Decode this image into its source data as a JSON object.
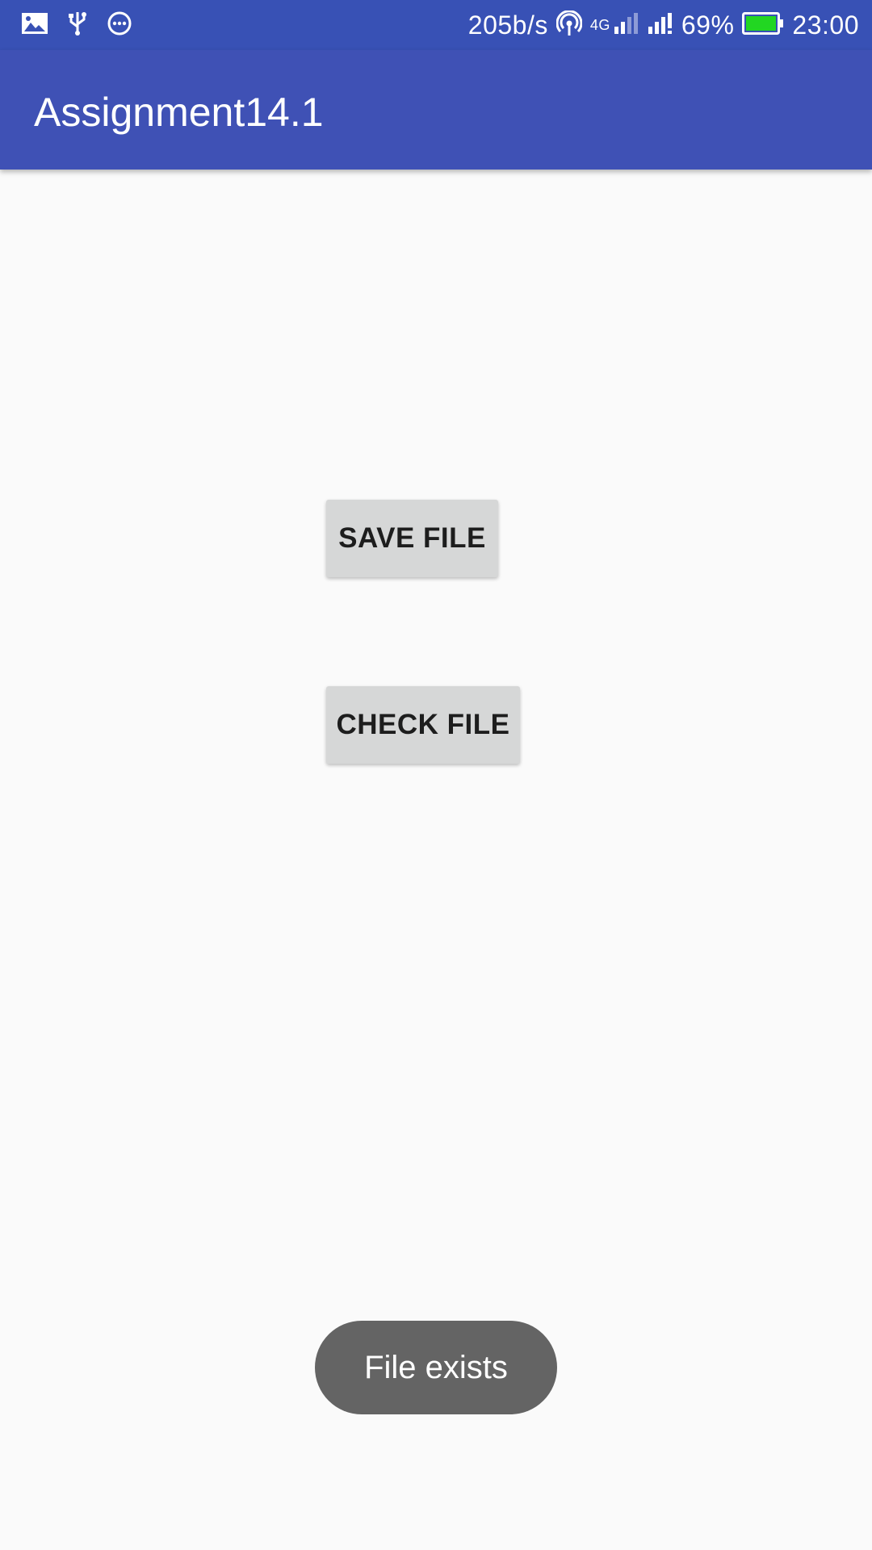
{
  "status_bar": {
    "icons_left": [
      "image-icon",
      "usb-icon",
      "more-icon"
    ],
    "network_speed": "205b/s",
    "network_type": "4G",
    "battery_percent": "69%",
    "battery_level": 0.69,
    "battery_color": "#22d622",
    "time": "23:00"
  },
  "app_bar": {
    "title": "Assignment14.1",
    "color": "#3f51b5"
  },
  "buttons": {
    "save_label": "SAVE FILE",
    "check_label": "CHECK FILE"
  },
  "toast": {
    "message": "File exists"
  }
}
